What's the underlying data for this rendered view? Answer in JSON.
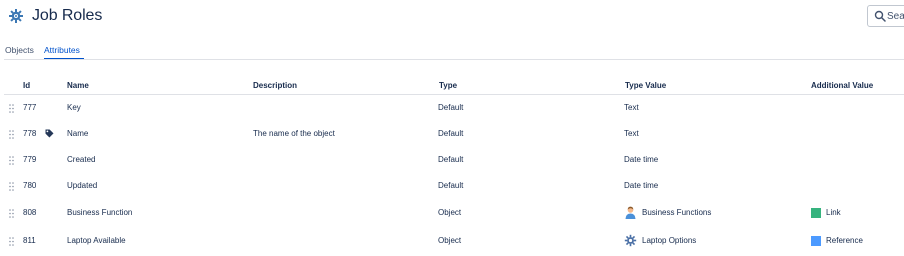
{
  "header": {
    "title": "Job Roles",
    "icon": "gear-icon",
    "search": {
      "placeholder": "Search",
      "value": ""
    }
  },
  "tabs": [
    {
      "label": "Objects",
      "active": false
    },
    {
      "label": "Attributes",
      "active": true
    }
  ],
  "table": {
    "columns": [
      "Id",
      "Name",
      "Description",
      "Type",
      "Type Value",
      "Additional Value"
    ],
    "rows": [
      {
        "id": "777",
        "name": "Key",
        "description": "",
        "type": "Default",
        "type_value": "Text",
        "type_value_icon": "",
        "additional_value": "",
        "additional_color": ""
      },
      {
        "id": "778",
        "name": "Name",
        "name_icon": "tag-icon",
        "description": "The name of the object",
        "type": "Default",
        "type_value": "Text",
        "type_value_icon": "",
        "additional_value": "",
        "additional_color": ""
      },
      {
        "id": "779",
        "name": "Created",
        "description": "",
        "type": "Default",
        "type_value": "Date time",
        "type_value_icon": "",
        "additional_value": "",
        "additional_color": ""
      },
      {
        "id": "780",
        "name": "Updated",
        "description": "",
        "type": "Default",
        "type_value": "Date time",
        "type_value_icon": "",
        "additional_value": "",
        "additional_color": ""
      },
      {
        "id": "808",
        "name": "Business Function",
        "description": "",
        "type": "Object",
        "type_value": "Business Functions",
        "type_value_icon": "person-icon",
        "additional_value": "Link",
        "additional_color": "#36b37e"
      },
      {
        "id": "811",
        "name": "Laptop Available",
        "description": "",
        "type": "Object",
        "type_value": "Laptop Options",
        "type_value_icon": "gear-icon",
        "additional_value": "Reference",
        "additional_color": "#4c9aff"
      }
    ]
  },
  "colors": {
    "accent": "#0052cc",
    "text": "#172b4d",
    "link_green": "#36b37e",
    "reference_blue": "#4c9aff"
  }
}
